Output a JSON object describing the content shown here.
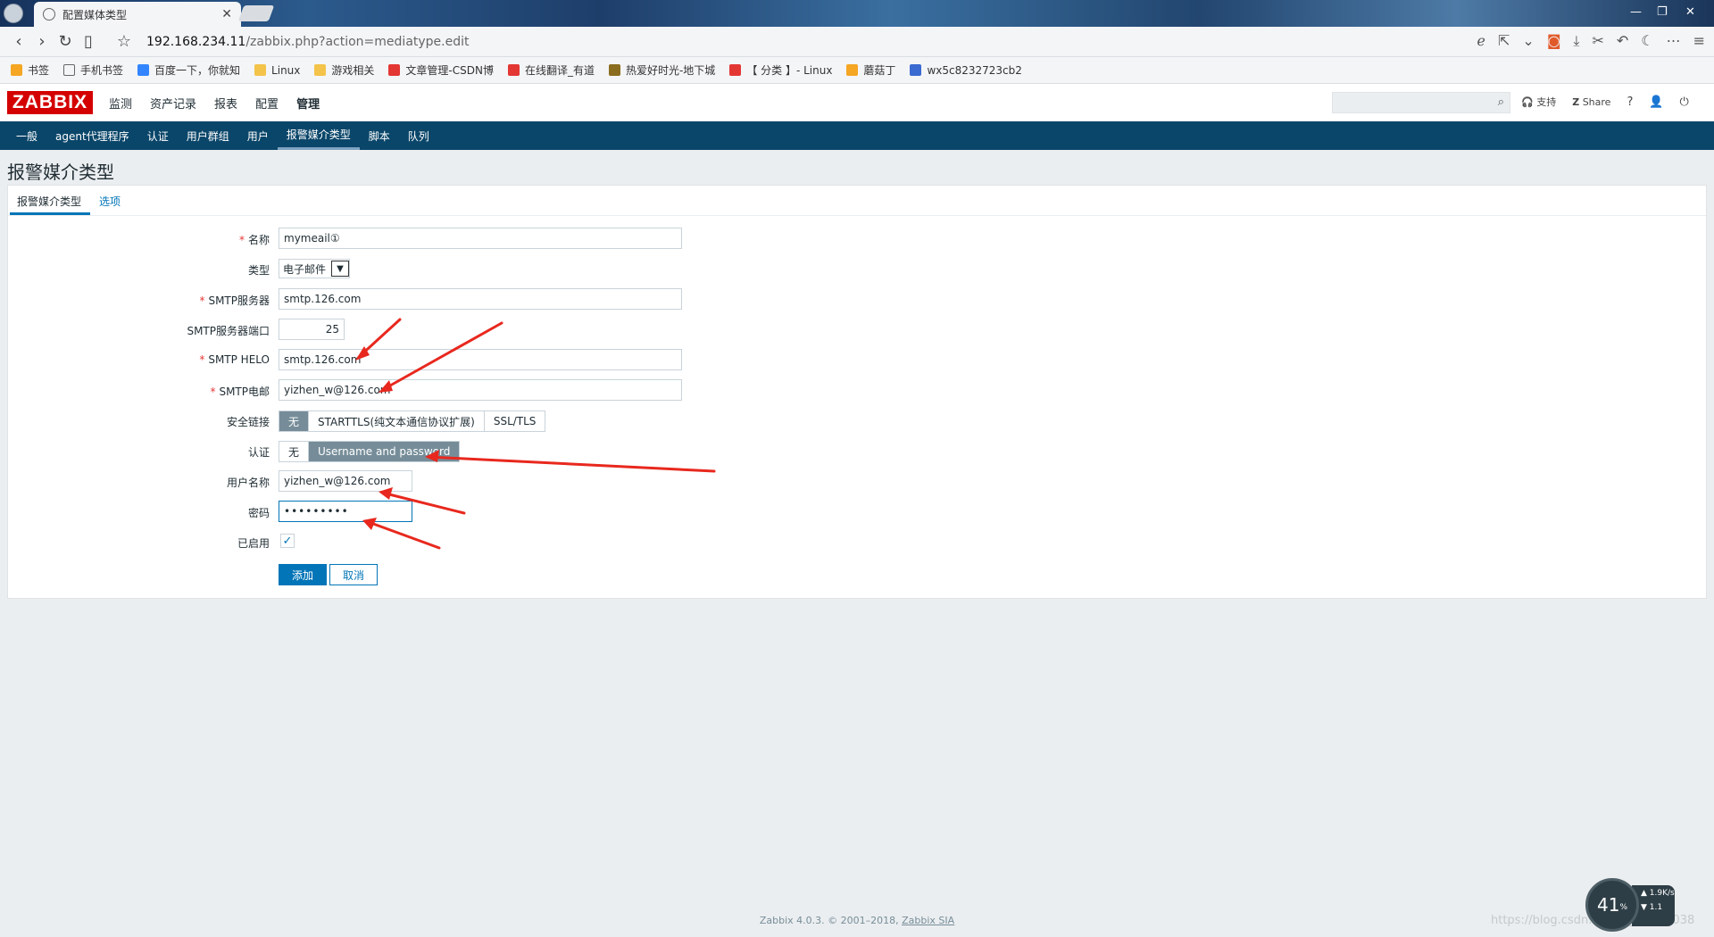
{
  "browser": {
    "tab_title": "配置媒体类型",
    "tab_close": "✕",
    "url_host": "192.168.234.11",
    "url_path": "/zabbix.php?action=mediatype.edit",
    "bookmarks": [
      {
        "label": "书签",
        "icon": "star-icon",
        "color": "#f5a623"
      },
      {
        "label": "手机书签",
        "icon": "phone-icon",
        "color": "#ffffff"
      },
      {
        "label": "百度一下，你就知",
        "icon": "baidu-icon",
        "color": "#3385ff"
      },
      {
        "label": "Linux",
        "icon": "folder-icon",
        "color": "#f3c34a"
      },
      {
        "label": "游戏相关",
        "icon": "folder-icon",
        "color": "#f3c34a"
      },
      {
        "label": "文章管理-CSDN博",
        "icon": "csdn-icon",
        "color": "#e33734"
      },
      {
        "label": "在线翻译_有道",
        "icon": "youdao-icon",
        "color": "#e33734"
      },
      {
        "label": "热爱好时光-地下城",
        "icon": "game-icon",
        "color": "#8a6d1f"
      },
      {
        "label": "【 分类 】- Linux",
        "icon": "csdn-icon",
        "color": "#e33734"
      },
      {
        "label": "蘑菇丁",
        "icon": "mushroom-icon",
        "color": "#f5a623"
      },
      {
        "label": "wx5c8232723cb2",
        "icon": "wx-icon",
        "color": "#3b6ad1"
      }
    ]
  },
  "zabbix": {
    "logo": "ZABBIX",
    "main_menu": [
      "监测",
      "资产记录",
      "报表",
      "配置",
      "管理"
    ],
    "active_main": "管理",
    "header_links": {
      "support": "支持",
      "share": "Share",
      "help": "?"
    },
    "sub_menu": [
      "一般",
      "agent代理程序",
      "认证",
      "用户群组",
      "用户",
      "报警媒介类型",
      "脚本",
      "队列"
    ],
    "active_sub": "报警媒介类型",
    "page_title": "报警媒介类型",
    "tabs": [
      "报警媒介类型",
      "选项"
    ],
    "form": {
      "name_label": "名称",
      "name_value": "mymeail①",
      "type_label": "类型",
      "type_value": "电子邮件",
      "smtp_server_label": "SMTP服务器",
      "smtp_server_value": "smtp.126.com",
      "smtp_port_label": "SMTP服务器端口",
      "smtp_port_value": "25",
      "smtp_helo_label": "SMTP HELO",
      "smtp_helo_value": "smtp.126.com",
      "smtp_email_label": "SMTP电邮",
      "smtp_email_value": "yizhen_w@126.com",
      "security_label": "安全链接",
      "security_options": [
        "无",
        "STARTTLS(纯文本通信协议扩展)",
        "SSL/TLS"
      ],
      "security_selected": "无",
      "auth_label": "认证",
      "auth_options": [
        "无",
        "Username and password"
      ],
      "auth_selected": "Username and password",
      "username_label": "用户名称",
      "username_value": "yizhen_w@126.com",
      "password_label": "密码",
      "password_value": "•••••••••",
      "enabled_label": "已启用",
      "enabled": true,
      "add_button": "添加",
      "cancel_button": "取消",
      "required_mark": "*"
    },
    "footer": {
      "text": "Zabbix 4.0.3. © 2001–2018, ",
      "link": "Zabbix SIA"
    }
  },
  "overlay": {
    "net_percent": "41",
    "net_unit": "%",
    "net_up": "1.9",
    "net_up_unit": "K/s",
    "net_down": "1.1",
    "watermark": "https://blog.csdn.net/qq_41682038",
    "arrow_color": "#e8281e"
  }
}
